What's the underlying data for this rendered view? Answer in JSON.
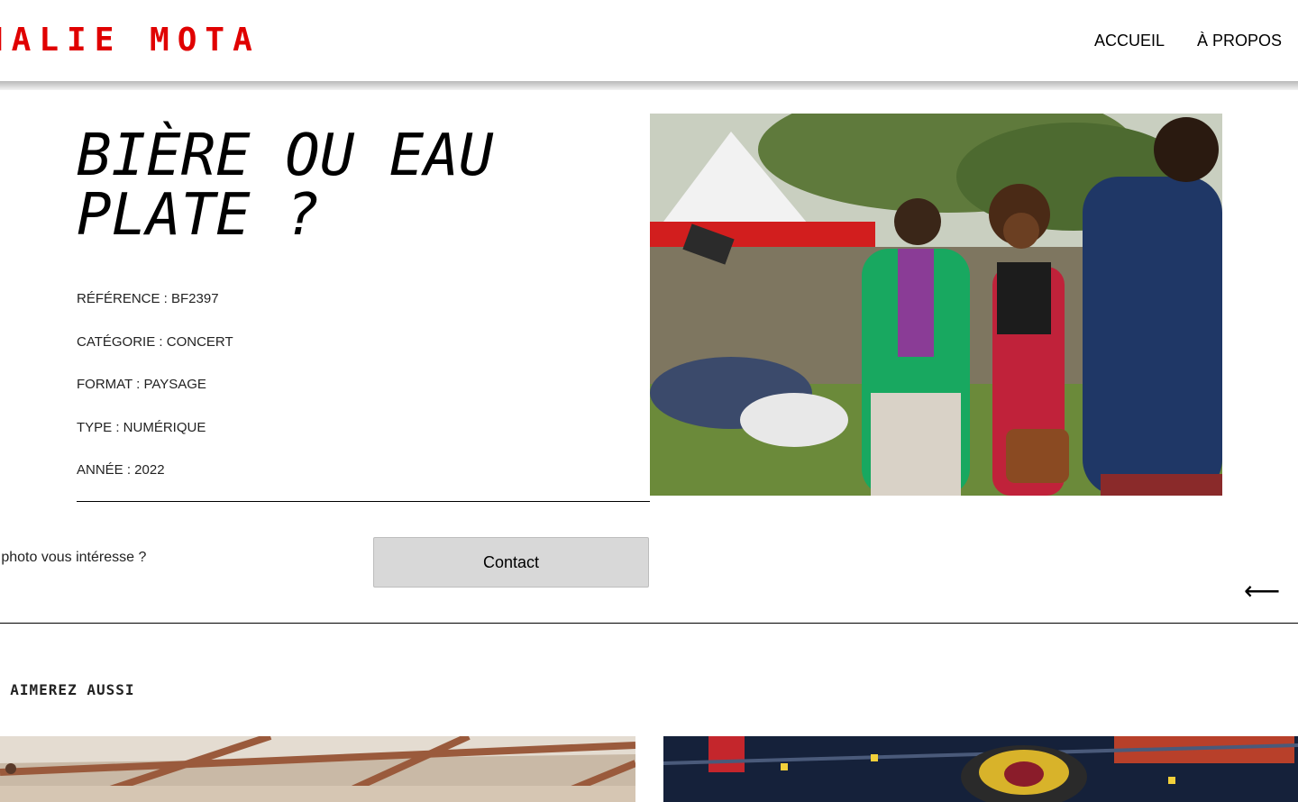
{
  "header": {
    "logo_text": "HALIE MOTA",
    "nav": [
      {
        "label": "ACCUEIL"
      },
      {
        "label": "À PROPOS"
      }
    ],
    "logo_color": "#e00000"
  },
  "photo": {
    "title": "BIÈRE OU EAU PLATE ?",
    "meta": [
      {
        "text": "RÉFÉRENCE : BF2397"
      },
      {
        "text": "CATÉGORIE : CONCERT"
      },
      {
        "text": "FORMAT : PAYSAGE"
      },
      {
        "text": "TYPE : NUMÉRIQUE"
      },
      {
        "text": "ANNÉE : 2022"
      }
    ]
  },
  "contact": {
    "prompt": "e photo vous intéresse ?",
    "button_label": "Contact"
  },
  "navigation": {
    "prev_arrow": "⟵"
  },
  "related": {
    "heading": "S AIMEREZ AUSSI"
  }
}
